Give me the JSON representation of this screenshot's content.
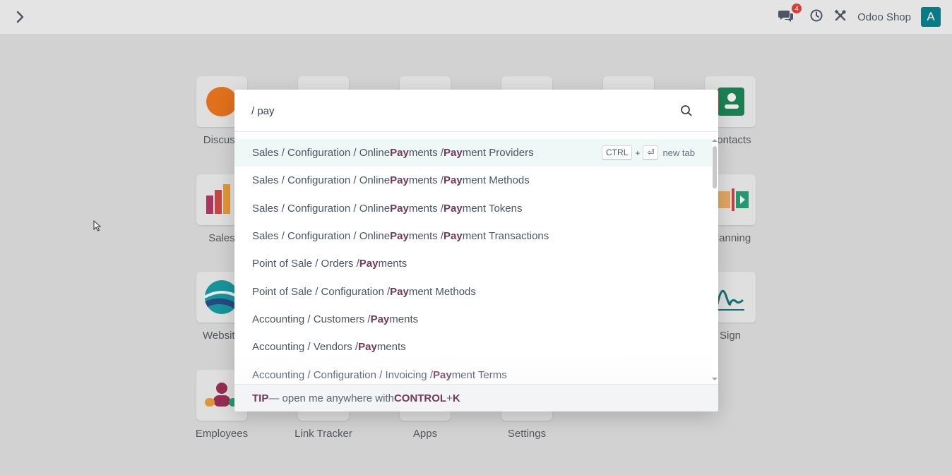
{
  "topbar": {
    "messages_badge": "4",
    "company_name": "Odoo Shop",
    "avatar_letter": "A"
  },
  "apps": [
    {
      "label": "Discuss"
    },
    {
      "label": "Contacts"
    },
    {
      "label": "Sales"
    },
    {
      "label": "Planning"
    },
    {
      "label": "Website"
    },
    {
      "label": "Sign"
    },
    {
      "label": "Employees"
    },
    {
      "label": "Link Tracker"
    },
    {
      "label": "Apps"
    },
    {
      "label": "Settings"
    }
  ],
  "palette": {
    "search_value": "/ pay",
    "shortcut": {
      "key1": "CTRL",
      "plus": "+",
      "key2": "⏎",
      "label": "new tab"
    },
    "results": [
      {
        "prefix": "Sales / Configuration / Online ",
        "m1": "Pay",
        "mid": "ments / ",
        "m2": "Pay",
        "suffix": "ment Providers"
      },
      {
        "prefix": "Sales / Configuration / Online ",
        "m1": "Pay",
        "mid": "ments / ",
        "m2": "Pay",
        "suffix": "ment Methods"
      },
      {
        "prefix": "Sales / Configuration / Online ",
        "m1": "Pay",
        "mid": "ments / ",
        "m2": "Pay",
        "suffix": "ment Tokens"
      },
      {
        "prefix": "Sales / Configuration / Online ",
        "m1": "Pay",
        "mid": "ments / ",
        "m2": "Pay",
        "suffix": "ment Transactions"
      },
      {
        "prefix": "Point of Sale / Orders / ",
        "m1": "Pay",
        "mid": "ments",
        "m2": "",
        "suffix": ""
      },
      {
        "prefix": "Point of Sale / Configuration / ",
        "m1": "Pay",
        "mid": "ment Methods",
        "m2": "",
        "suffix": ""
      },
      {
        "prefix": "Accounting / Customers / ",
        "m1": "Pay",
        "mid": "ments",
        "m2": "",
        "suffix": ""
      },
      {
        "prefix": "Accounting / Vendors / ",
        "m1": "Pay",
        "mid": "ments",
        "m2": "",
        "suffix": ""
      },
      {
        "prefix": "Accounting / Configuration / Invoicing / ",
        "m1": "Pay",
        "mid": "ment Terms",
        "m2": "",
        "suffix": ""
      }
    ],
    "tip": {
      "label": "TIP",
      "text": " — open me anywhere with ",
      "k1": "CONTROL",
      "plus": " + ",
      "k2": "K"
    }
  },
  "colors": {
    "accent": "#71395a",
    "avatar": "#0b7a87",
    "badge": "#d43f3a",
    "active_row": "#eef8f6"
  }
}
